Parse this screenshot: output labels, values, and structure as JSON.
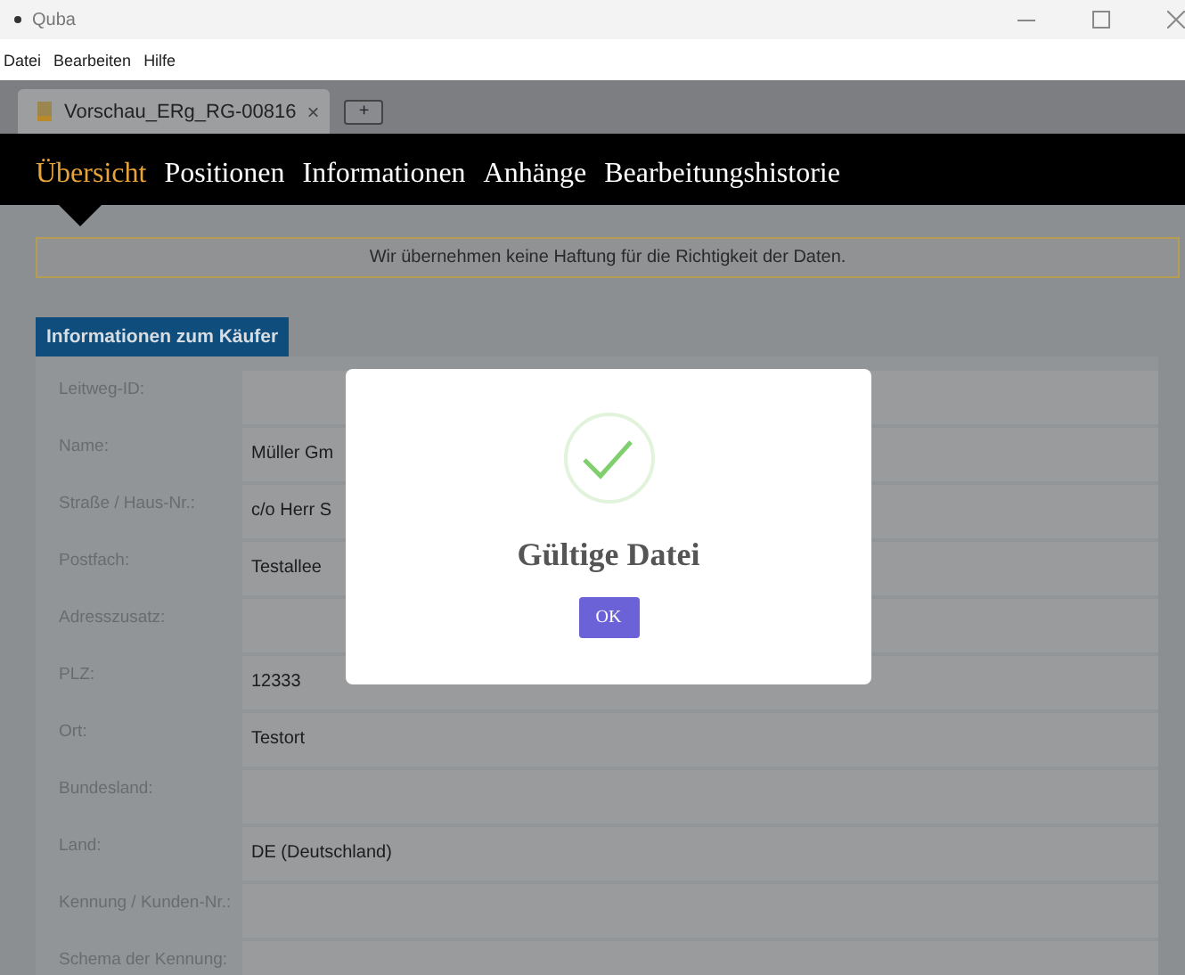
{
  "window": {
    "title": "Quba"
  },
  "menu": [
    "Datei",
    "Bearbeiten",
    "Hilfe"
  ],
  "document_tabs": [
    {
      "label": "Vorschau_ERg_RG-00816",
      "close": "×",
      "selected": true
    }
  ],
  "new_tab_button": "+",
  "nav_tabs": [
    {
      "label": "Übersicht",
      "selected": true
    },
    {
      "label": "Positionen",
      "selected": false
    },
    {
      "label": "Informationen",
      "selected": false
    },
    {
      "label": "Anhänge",
      "selected": false
    },
    {
      "label": "Bearbeitungshistorie",
      "selected": false
    }
  ],
  "notice": "Wir übernehmen keine Haftung für die Richtigkeit der Daten.",
  "section": {
    "title": "Informationen zum Käufer",
    "fields": [
      {
        "label": "Leitweg-ID:"
      },
      {
        "label": "Name:",
        "value": "Müller Gm"
      },
      {
        "label": "Straße / Haus-Nr.:",
        "value": "c/o Herr S"
      },
      {
        "label": "Postfach:",
        "value": "Testallee"
      },
      {
        "label": "Adresszusatz:"
      },
      {
        "label": "PLZ:",
        "value": "12333"
      },
      {
        "label": "Ort:",
        "value": "Testort"
      },
      {
        "label": "Bundesland:"
      },
      {
        "label": "Land:",
        "value": "DE (Deutschland)"
      },
      {
        "label": "Kennung / Kunden-Nr.:"
      },
      {
        "label": "Schema der Kennung:"
      }
    ]
  },
  "dialog": {
    "title": "Gültige Datei",
    "button": "OK"
  }
}
